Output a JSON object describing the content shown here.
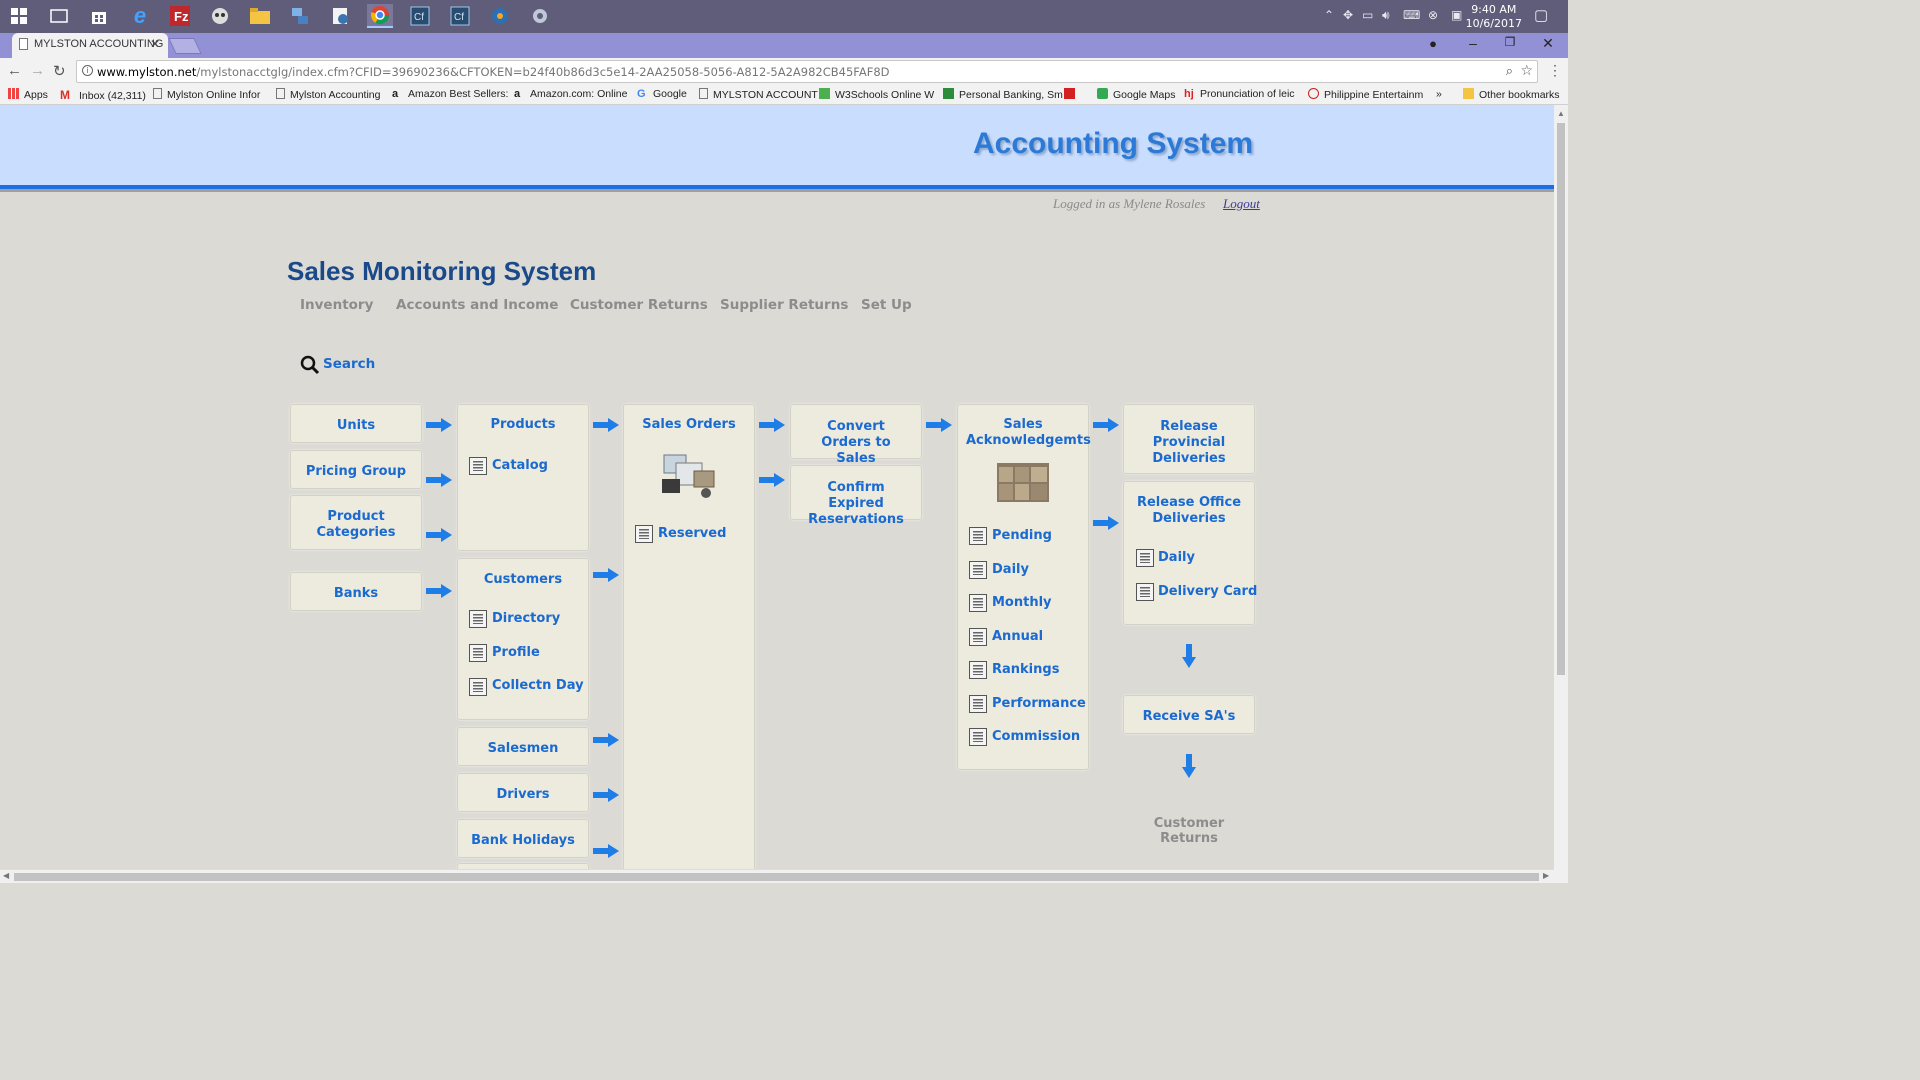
{
  "taskbar": {
    "clock_time": "9:40 AM",
    "clock_date": "10/6/2017"
  },
  "browser": {
    "tab_title": "MYLSTON ACCOUNTING",
    "url_host": "www.mylston.net",
    "url_path": "/mylstonacctglg/index.cfm?CFID=39690236&CFTOKEN=b24f40b86d3c5e14-2AA25058-5056-A812-5A2A982CB45FAF8D",
    "bookmarks": [
      "Apps",
      "Inbox (42,311)",
      "Mylston Online Infor",
      "Mylston Accounting",
      "Amazon Best Sellers:",
      "Amazon.com: Online",
      "Google",
      "MYLSTON ACCOUNT",
      "W3Schools Online W",
      "Personal Banking, Sm",
      "Google Maps",
      "Pronunciation of leic",
      "Philippine Entertainm"
    ],
    "other_bookmarks": "Other bookmarks",
    "more_bookmarks": "»"
  },
  "header": {
    "title": "Accounting System",
    "logged_in": "Logged in as Mylene Rosales",
    "logout": "Logout"
  },
  "page": {
    "title": "Sales Monitoring System",
    "nav": [
      "Inventory",
      "Accounts and Income",
      "Customer Returns",
      "Supplier Returns",
      "Set Up"
    ],
    "search": "Search"
  },
  "flow": {
    "col1": [
      "Units",
      "Pricing Group",
      "Product Categories",
      "Banks"
    ],
    "products": {
      "title": "Products",
      "items": [
        "Catalog"
      ]
    },
    "customers": {
      "title": "Customers",
      "items": [
        "Directory",
        "Profile",
        "Collectn Day"
      ]
    },
    "col2_more": [
      "Salesmen",
      "Drivers",
      "Bank Holidays"
    ],
    "sales_orders": {
      "title": "Sales Orders",
      "items": [
        "Reserved"
      ]
    },
    "convert": "Convert Orders to Sales",
    "confirm": "Confirm Expired Reservations",
    "ack": {
      "title": "Sales Acknowledgemts",
      "items": [
        "Pending",
        "Daily",
        "Monthly",
        "Annual",
        "Rankings",
        "Performance",
        "Commission"
      ]
    },
    "release_prov": "Release Provincial Deliveries",
    "release_office": {
      "title": "Release Office Deliveries",
      "items": [
        "Daily",
        "Delivery Card"
      ]
    },
    "receive": "Receive SA's",
    "customer_returns": "Customer Returns"
  }
}
